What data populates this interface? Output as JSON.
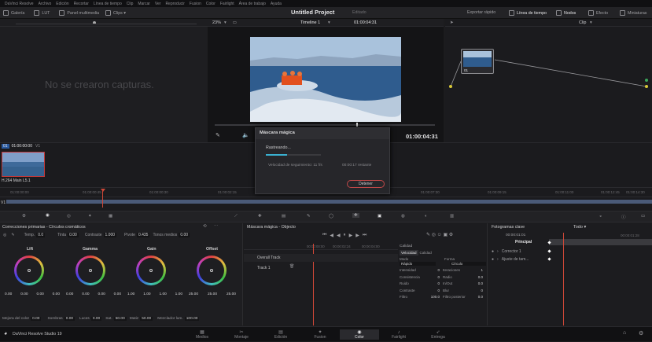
{
  "menu": [
    "DaVinci Resolve",
    "Archivo",
    "Edición",
    "Recortar",
    "Línea de tiempo",
    "Clip",
    "Marcar",
    "Ver",
    "Reproducir",
    "Fusion",
    "Color",
    "Fairlight",
    "Área de trabajo",
    "Ayuda"
  ],
  "toolbar": {
    "galeria": "Galería",
    "lut": "LUT",
    "panel": "Panel multimedia",
    "clips": "Clips",
    "project_title": "Untitled Project",
    "status": "Editado",
    "export": "Exportar rápido",
    "timeline": "Línea de tiempo",
    "nodes": "Nodos",
    "effects": "Efecto",
    "thumbs": "Miniaturas"
  },
  "gallery": {
    "empty": "No se crearon capturas."
  },
  "viewer": {
    "zoom": "23%",
    "timeline_name": "Timeline 1",
    "timecode_top": "01:00:04:31",
    "clip_label": "Clip",
    "timecode": "01:00:04:31"
  },
  "nodes": {
    "node_label": "01"
  },
  "timeline": {
    "clip_num": "01",
    "clip_tc": "01:00:00:00",
    "clip_track": "V1",
    "clip_name": "H.264 Main L5.1",
    "track": "V1",
    "ticks": [
      "01:00:00:00",
      "01:00:00:45",
      "01:00:00:30",
      "01:00:02:15",
      "01:00:04:00",
      "01:00:05:45",
      "01:00:07:30",
      "01:00:09:15",
      "01:00:11:00",
      "01:00:12:45",
      "01:00:14:30"
    ]
  },
  "modal": {
    "title": "Máscara mágica",
    "tracking": "Rastreando...",
    "speed": "Velocidad de seguimiento: 11 f/s",
    "remaining": "00:00:17 restante",
    "progress": 0.38,
    "cancel": "Detener"
  },
  "primaries": {
    "title": "Correcciones primarias - Círculos cromáticos",
    "temp_label": "Temp.",
    "temp": "0.0",
    "tint_label": "Tinta",
    "tint": "0.00",
    "contrast_label": "Contraste",
    "contrast": "1.000",
    "pivot_label": "Pivote",
    "pivot": "0.435",
    "mid_label": "Tonos medios",
    "mid": "0.00",
    "wheels": [
      {
        "name": "Lift",
        "vals": [
          "0.00",
          "0.00",
          "0.00",
          "0.00"
        ]
      },
      {
        "name": "Gamma",
        "vals": [
          "0.00",
          "0.00",
          "0.00",
          "0.00"
        ]
      },
      {
        "name": "Gain",
        "vals": [
          "1.00",
          "1.00",
          "1.00",
          "1.00"
        ]
      },
      {
        "name": "Offset",
        "vals": [
          "25.00",
          "25.00",
          "25.00"
        ]
      }
    ],
    "bottom": [
      {
        "l": "Mejora del color",
        "v": "0.00"
      },
      {
        "l": "Sombras",
        "v": "0.00"
      },
      {
        "l": "Luces",
        "v": "0.00"
      },
      {
        "l": "Sat.",
        "v": "50.00"
      },
      {
        "l": "Matiz",
        "v": "50.00"
      },
      {
        "l": "Mezclador lum.",
        "v": "100.00"
      }
    ]
  },
  "mask": {
    "title": "Máscara mágica - Objecto",
    "overall": "Overall Track",
    "track1": "Track 1",
    "tc1": "00:00:00:00",
    "tc2": "00:00:02:24",
    "tc3": "00:00:04:00",
    "quality_section": "Calidad",
    "tab1": "Velocidad",
    "tab2": "Calidad",
    "mode_label": "Modo",
    "mode_val": "Rápido",
    "shape_label": "Forma",
    "shape_val": "Círculo",
    "params": [
      {
        "l": "Intensidad",
        "v": "0"
      },
      {
        "l": "Iteraciones",
        "v": "1"
      },
      {
        "l": "Consistencia",
        "v": "0"
      },
      {
        "l": "Radio",
        "v": "0.0"
      },
      {
        "l": "Ruido",
        "v": "0"
      },
      {
        "l": "In/Out",
        "v": "0.0"
      },
      {
        "l": "Contraste",
        "v": "0"
      },
      {
        "l": "Blur",
        "v": "0"
      },
      {
        "l": "Filtro",
        "v": "100.0"
      },
      {
        "l": "Filtro posterior",
        "v": "0.0"
      }
    ]
  },
  "keyframes": {
    "title": "Fotogramas clave",
    "mode": "Todo",
    "tc": "00:00:01:01",
    "tc2": "00:00:01:28",
    "principal": "Principal",
    "rows": [
      "Corrector 1",
      "Ajuste de tam..."
    ]
  },
  "pages": {
    "app": "DaVinci Resolve Studio 19",
    "items": [
      "Medios",
      "Montaje",
      "Edición",
      "Fusion",
      "Color",
      "Fairlight",
      "Entrega"
    ],
    "active": "Color"
  }
}
